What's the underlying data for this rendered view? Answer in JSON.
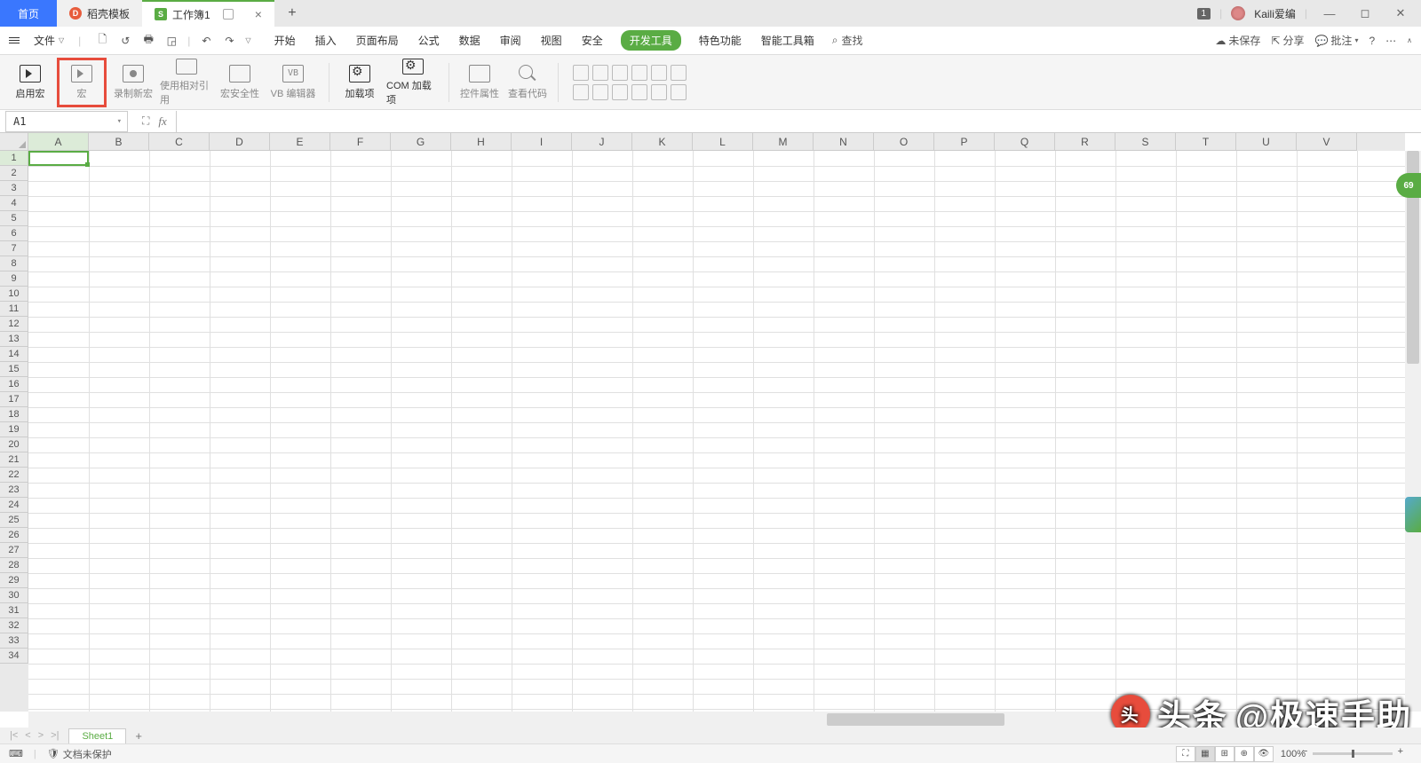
{
  "titlebar": {
    "home": "首页",
    "template": "稻壳模板",
    "workbook": "工作簿1",
    "badge": "1",
    "user": "Kaili爱编"
  },
  "menubar": {
    "file": "文件",
    "tabs": [
      "开始",
      "插入",
      "页面布局",
      "公式",
      "数据",
      "审阅",
      "视图",
      "安全",
      "开发工具",
      "特色功能",
      "智能工具箱"
    ],
    "active_index": 8,
    "find": "查找",
    "unsaved": "未保存",
    "share": "分享",
    "comment": "批注"
  },
  "ribbon": {
    "enable_macro": "启用宏",
    "macro": "宏",
    "record_macro": "录制新宏",
    "relative_ref": "使用相对引用",
    "macro_security": "宏安全性",
    "vb_editor": "VB 编辑器",
    "addins": "加载项",
    "com_addins": "COM 加载项",
    "control_props": "控件属性",
    "view_code": "查看代码"
  },
  "formulabar": {
    "name": "A1"
  },
  "columns": [
    "A",
    "B",
    "C",
    "D",
    "E",
    "F",
    "G",
    "H",
    "I",
    "J",
    "K",
    "L",
    "M",
    "N",
    "O",
    "P",
    "Q",
    "R",
    "S",
    "T",
    "U",
    "V"
  ],
  "row_count": 34,
  "sheetbar": {
    "sheet": "Sheet1"
  },
  "statusbar": {
    "protect": "文档未保护",
    "zoom": "100%"
  },
  "float_badge": "69",
  "watermark": {
    "prefix": "头条",
    "account": "@极速手助"
  }
}
